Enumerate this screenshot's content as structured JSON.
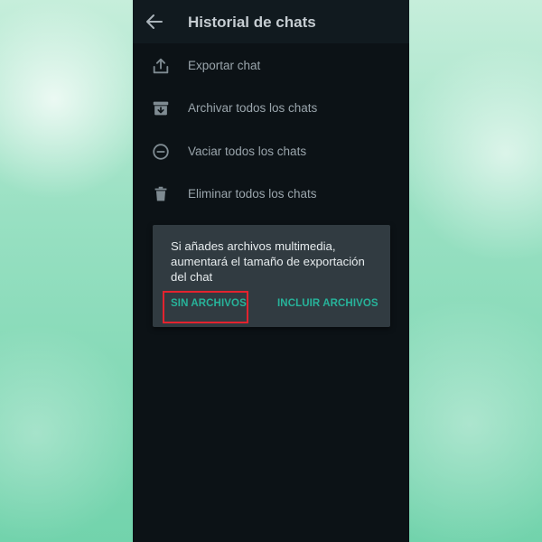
{
  "header": {
    "title": "Historial de chats",
    "back_icon": "arrow-left-icon"
  },
  "menu": {
    "items": [
      {
        "label": "Exportar chat",
        "icon": "export-icon"
      },
      {
        "label": "Archivar todos los chats",
        "icon": "archive-icon"
      },
      {
        "label": "Vaciar todos los chats",
        "icon": "minus-circle-icon"
      },
      {
        "label": "Eliminar todos los chats",
        "icon": "trash-icon"
      }
    ]
  },
  "dialog": {
    "message": "Si añades archivos multimedia, aumentará el tamaño de exportación del chat",
    "buttons": {
      "without_media": "SIN ARCHIVOS",
      "include_media": "INCLUIR ARCHIVOS"
    }
  },
  "colors": {
    "background": "#0c1216",
    "appbar": "#111a1f",
    "dialog": "#313b41",
    "accent": "#27b39a",
    "highlight": "#e3232e"
  }
}
